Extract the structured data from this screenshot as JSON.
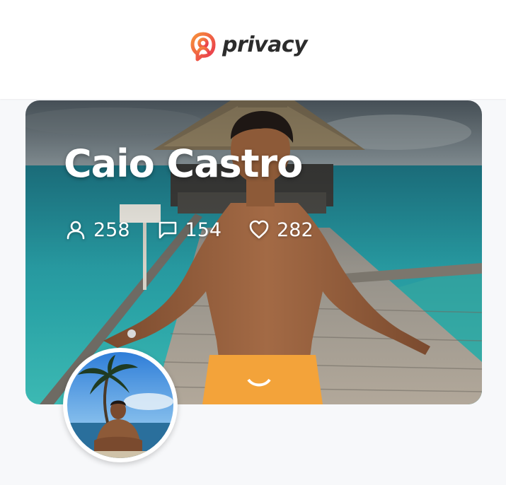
{
  "app": {
    "brand": "privacy",
    "brand_color": "#f26b3a",
    "brand_color_secondary": "#e8344e"
  },
  "profile": {
    "name": "Caio Castro",
    "stats": [
      {
        "icon": "user-icon",
        "value": "258"
      },
      {
        "icon": "chat-icon",
        "value": "154"
      },
      {
        "icon": "heart-icon",
        "value": "282"
      }
    ],
    "cover_image": "man-on-pier-cover-photo",
    "avatar_image": "man-by-palm-beach-avatar"
  }
}
